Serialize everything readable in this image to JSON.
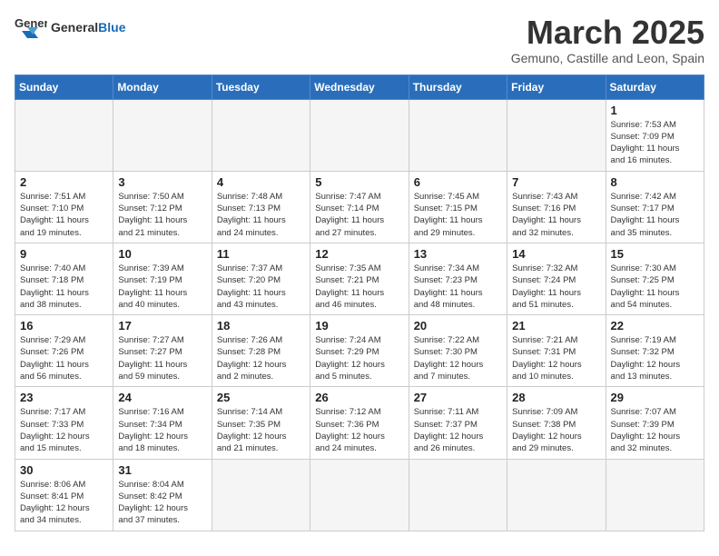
{
  "header": {
    "logo_general": "General",
    "logo_blue": "Blue",
    "month_title": "March 2025",
    "subtitle": "Gemuno, Castille and Leon, Spain"
  },
  "weekdays": [
    "Sunday",
    "Monday",
    "Tuesday",
    "Wednesday",
    "Thursday",
    "Friday",
    "Saturday"
  ],
  "weeks": [
    [
      {
        "day": "",
        "info": ""
      },
      {
        "day": "",
        "info": ""
      },
      {
        "day": "",
        "info": ""
      },
      {
        "day": "",
        "info": ""
      },
      {
        "day": "",
        "info": ""
      },
      {
        "day": "",
        "info": ""
      },
      {
        "day": "1",
        "info": "Sunrise: 7:53 AM\nSunset: 7:09 PM\nDaylight: 11 hours\nand 16 minutes."
      }
    ],
    [
      {
        "day": "2",
        "info": "Sunrise: 7:51 AM\nSunset: 7:10 PM\nDaylight: 11 hours\nand 19 minutes."
      },
      {
        "day": "3",
        "info": "Sunrise: 7:50 AM\nSunset: 7:12 PM\nDaylight: 11 hours\nand 21 minutes."
      },
      {
        "day": "4",
        "info": "Sunrise: 7:48 AM\nSunset: 7:13 PM\nDaylight: 11 hours\nand 24 minutes."
      },
      {
        "day": "5",
        "info": "Sunrise: 7:47 AM\nSunset: 7:14 PM\nDaylight: 11 hours\nand 27 minutes."
      },
      {
        "day": "6",
        "info": "Sunrise: 7:45 AM\nSunset: 7:15 PM\nDaylight: 11 hours\nand 29 minutes."
      },
      {
        "day": "7",
        "info": "Sunrise: 7:43 AM\nSunset: 7:16 PM\nDaylight: 11 hours\nand 32 minutes."
      },
      {
        "day": "8",
        "info": "Sunrise: 7:42 AM\nSunset: 7:17 PM\nDaylight: 11 hours\nand 35 minutes."
      }
    ],
    [
      {
        "day": "9",
        "info": "Sunrise: 7:40 AM\nSunset: 7:18 PM\nDaylight: 11 hours\nand 38 minutes."
      },
      {
        "day": "10",
        "info": "Sunrise: 7:39 AM\nSunset: 7:19 PM\nDaylight: 11 hours\nand 40 minutes."
      },
      {
        "day": "11",
        "info": "Sunrise: 7:37 AM\nSunset: 7:20 PM\nDaylight: 11 hours\nand 43 minutes."
      },
      {
        "day": "12",
        "info": "Sunrise: 7:35 AM\nSunset: 7:21 PM\nDaylight: 11 hours\nand 46 minutes."
      },
      {
        "day": "13",
        "info": "Sunrise: 7:34 AM\nSunset: 7:23 PM\nDaylight: 11 hours\nand 48 minutes."
      },
      {
        "day": "14",
        "info": "Sunrise: 7:32 AM\nSunset: 7:24 PM\nDaylight: 11 hours\nand 51 minutes."
      },
      {
        "day": "15",
        "info": "Sunrise: 7:30 AM\nSunset: 7:25 PM\nDaylight: 11 hours\nand 54 minutes."
      }
    ],
    [
      {
        "day": "16",
        "info": "Sunrise: 7:29 AM\nSunset: 7:26 PM\nDaylight: 11 hours\nand 56 minutes."
      },
      {
        "day": "17",
        "info": "Sunrise: 7:27 AM\nSunset: 7:27 PM\nDaylight: 11 hours\nand 59 minutes."
      },
      {
        "day": "18",
        "info": "Sunrise: 7:26 AM\nSunset: 7:28 PM\nDaylight: 12 hours\nand 2 minutes."
      },
      {
        "day": "19",
        "info": "Sunrise: 7:24 AM\nSunset: 7:29 PM\nDaylight: 12 hours\nand 5 minutes."
      },
      {
        "day": "20",
        "info": "Sunrise: 7:22 AM\nSunset: 7:30 PM\nDaylight: 12 hours\nand 7 minutes."
      },
      {
        "day": "21",
        "info": "Sunrise: 7:21 AM\nSunset: 7:31 PM\nDaylight: 12 hours\nand 10 minutes."
      },
      {
        "day": "22",
        "info": "Sunrise: 7:19 AM\nSunset: 7:32 PM\nDaylight: 12 hours\nand 13 minutes."
      }
    ],
    [
      {
        "day": "23",
        "info": "Sunrise: 7:17 AM\nSunset: 7:33 PM\nDaylight: 12 hours\nand 15 minutes."
      },
      {
        "day": "24",
        "info": "Sunrise: 7:16 AM\nSunset: 7:34 PM\nDaylight: 12 hours\nand 18 minutes."
      },
      {
        "day": "25",
        "info": "Sunrise: 7:14 AM\nSunset: 7:35 PM\nDaylight: 12 hours\nand 21 minutes."
      },
      {
        "day": "26",
        "info": "Sunrise: 7:12 AM\nSunset: 7:36 PM\nDaylight: 12 hours\nand 24 minutes."
      },
      {
        "day": "27",
        "info": "Sunrise: 7:11 AM\nSunset: 7:37 PM\nDaylight: 12 hours\nand 26 minutes."
      },
      {
        "day": "28",
        "info": "Sunrise: 7:09 AM\nSunset: 7:38 PM\nDaylight: 12 hours\nand 29 minutes."
      },
      {
        "day": "29",
        "info": "Sunrise: 7:07 AM\nSunset: 7:39 PM\nDaylight: 12 hours\nand 32 minutes."
      }
    ],
    [
      {
        "day": "30",
        "info": "Sunrise: 8:06 AM\nSunset: 8:41 PM\nDaylight: 12 hours\nand 34 minutes."
      },
      {
        "day": "31",
        "info": "Sunrise: 8:04 AM\nSunset: 8:42 PM\nDaylight: 12 hours\nand 37 minutes."
      },
      {
        "day": "",
        "info": ""
      },
      {
        "day": "",
        "info": ""
      },
      {
        "day": "",
        "info": ""
      },
      {
        "day": "",
        "info": ""
      },
      {
        "day": "",
        "info": ""
      }
    ]
  ]
}
